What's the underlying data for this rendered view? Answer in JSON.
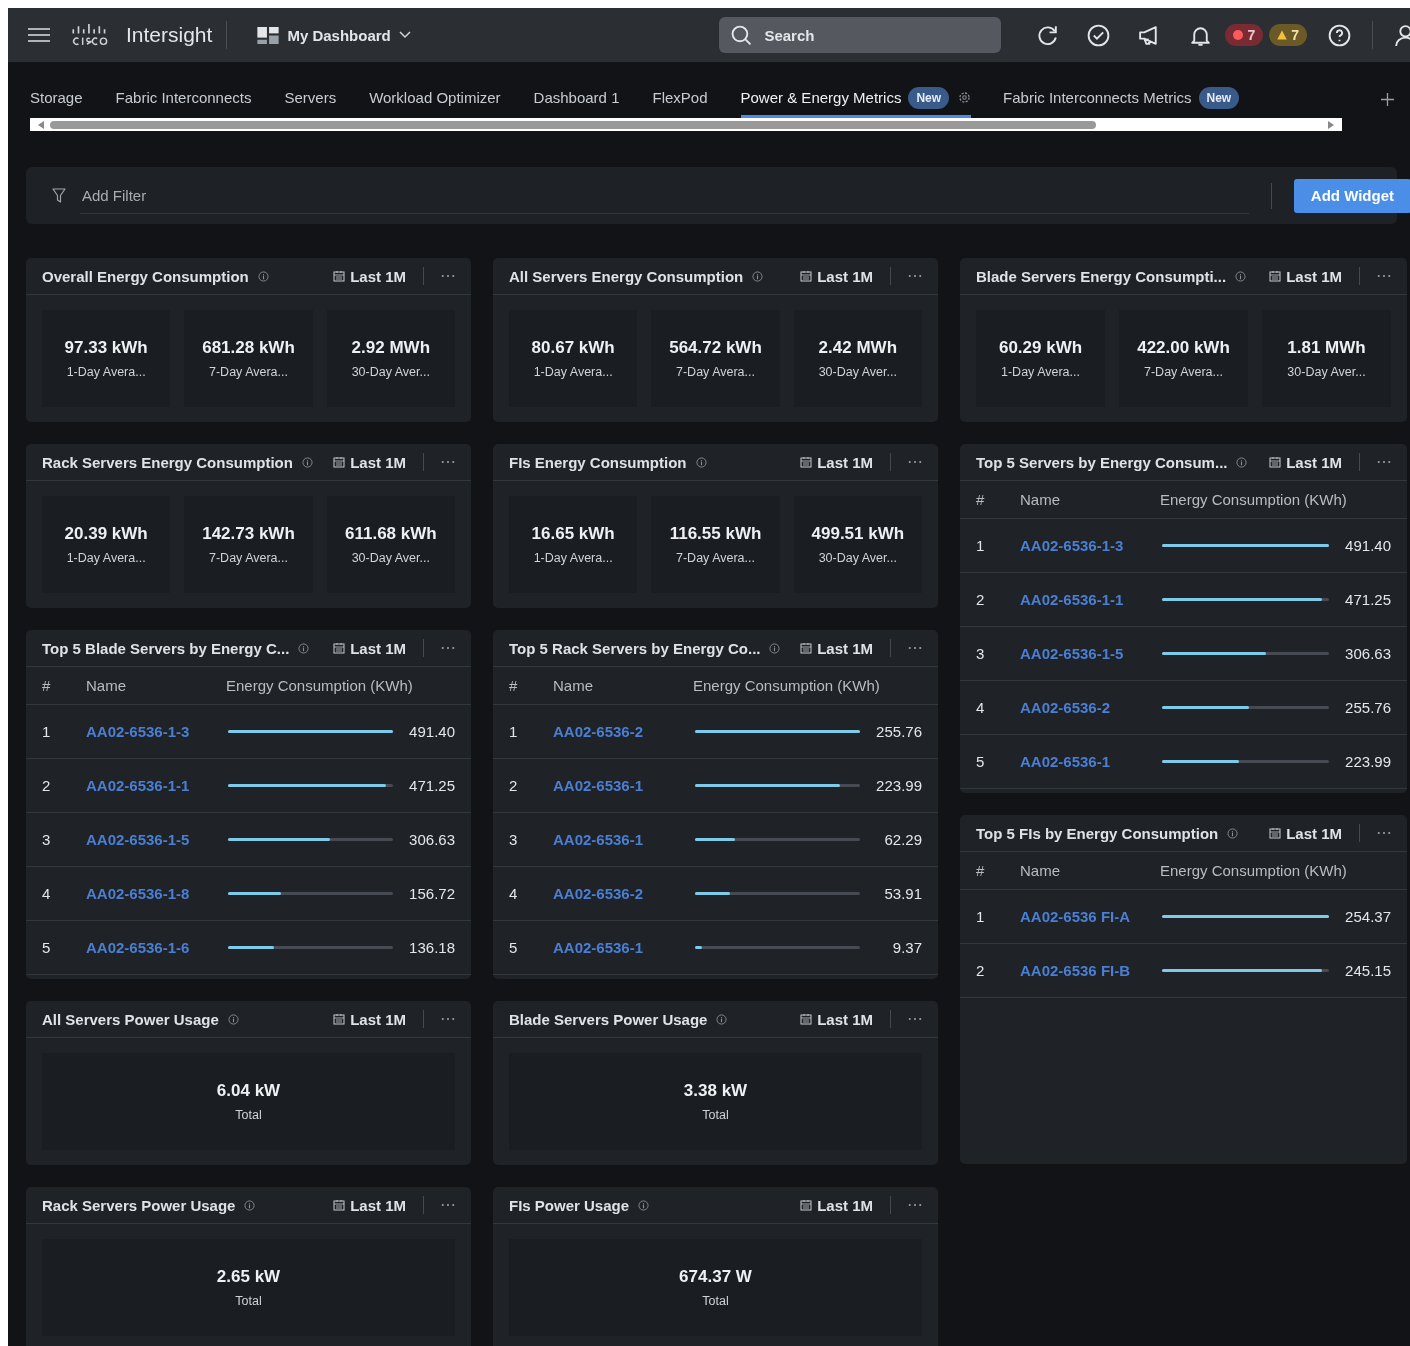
{
  "header": {
    "brand": "Intersight",
    "dashboard": "My Dashboard",
    "search": {
      "placeholder": "Search"
    },
    "alerts": [
      {
        "kind": "error",
        "count": "7"
      },
      {
        "kind": "warning",
        "count": "7"
      }
    ]
  },
  "tabs": [
    {
      "label": "Storage",
      "selected": false
    },
    {
      "label": "Fabric Interconnects",
      "selected": false
    },
    {
      "label": "Servers",
      "selected": false
    },
    {
      "label": "Workload Optimizer",
      "selected": false
    },
    {
      "label": "Dashboard 1",
      "selected": false
    },
    {
      "label": "FlexPod",
      "selected": false
    },
    {
      "label": "Power & Energy Metrics",
      "selected": true,
      "badge": "New",
      "settings": true
    },
    {
      "label": "Fabric Interconnects Metrics",
      "selected": false,
      "badge": "New",
      "settings": false
    }
  ],
  "filter": {
    "placeholder": "Add Filter"
  },
  "add_widget": "Add Widget",
  "columns": [
    [
      {
        "kind": "stats",
        "title": "Overall Energy Consumption",
        "range": "Last 1M",
        "stats": [
          {
            "value": "97.33 kWh",
            "label": "1-Day Avera..."
          },
          {
            "value": "681.28 kWh",
            "label": "7-Day Avera..."
          },
          {
            "value": "2.92 MWh",
            "label": "30-Day Aver..."
          }
        ]
      },
      {
        "kind": "stats",
        "title": "Rack Servers Energy Consumption",
        "range": "Last 1M",
        "stats": [
          {
            "value": "20.39 kWh",
            "label": "1-Day Avera..."
          },
          {
            "value": "142.73 kWh",
            "label": "7-Day Avera..."
          },
          {
            "value": "611.68 kWh",
            "label": "30-Day Aver..."
          }
        ]
      },
      {
        "kind": "table",
        "title": "Top 5 Blade Servers by Energy C...",
        "range": "Last 1M",
        "columns": [
          "#",
          "Name",
          "Energy Consumption (KWh)"
        ],
        "rows": [
          {
            "rank": "1",
            "name": "AA02-6536-1-3",
            "level": 1,
            "value": "491.40"
          },
          {
            "rank": "2",
            "name": "AA02-6536-1-1",
            "level": 0.96,
            "value": "471.25"
          },
          {
            "rank": "3",
            "name": "AA02-6536-1-5",
            "level": 0.62,
            "value": "306.63"
          },
          {
            "rank": "4",
            "name": "AA02-6536-1-8",
            "level": 0.32,
            "value": "156.72"
          },
          {
            "rank": "5",
            "name": "AA02-6536-1-6",
            "level": 0.28,
            "value": "136.18"
          }
        ]
      },
      {
        "kind": "total",
        "title": "All Servers Power Usage",
        "range": "Last 1M",
        "value": "6.04 kW",
        "label": "Total"
      },
      {
        "kind": "total",
        "title": "Rack Servers Power Usage",
        "range": "Last 1M",
        "value": "2.65 kW",
        "label": "Total"
      }
    ],
    [
      {
        "kind": "stats",
        "title": "All Servers Energy Consumption",
        "range": "Last 1M",
        "stats": [
          {
            "value": "80.67 kWh",
            "label": "1-Day Avera..."
          },
          {
            "value": "564.72 kWh",
            "label": "7-Day Avera..."
          },
          {
            "value": "2.42 MWh",
            "label": "30-Day Aver..."
          }
        ]
      },
      {
        "kind": "stats",
        "title": "FIs Energy Consumption",
        "range": "Last 1M",
        "stats": [
          {
            "value": "16.65 kWh",
            "label": "1-Day Avera..."
          },
          {
            "value": "116.55 kWh",
            "label": "7-Day Avera..."
          },
          {
            "value": "499.51 kWh",
            "label": "30-Day Aver..."
          }
        ]
      },
      {
        "kind": "table",
        "title": "Top 5 Rack Servers by Energy Co...",
        "range": "Last 1M",
        "columns": [
          "#",
          "Name",
          "Energy Consumption (KWh)"
        ],
        "rows": [
          {
            "rank": "1",
            "name": "AA02-6536-2",
            "level": 1,
            "value": "255.76"
          },
          {
            "rank": "2",
            "name": "AA02-6536-1",
            "level": 0.88,
            "value": "223.99"
          },
          {
            "rank": "3",
            "name": "AA02-6536-1",
            "level": 0.24,
            "value": "62.29"
          },
          {
            "rank": "4",
            "name": "AA02-6536-2",
            "level": 0.21,
            "value": "53.91"
          },
          {
            "rank": "5",
            "name": "AA02-6536-1",
            "level": 0.04,
            "value": "9.37"
          }
        ]
      },
      {
        "kind": "total",
        "title": "Blade Servers Power Usage",
        "range": "Last 1M",
        "value": "3.38 kW",
        "label": "Total"
      },
      {
        "kind": "total",
        "title": "FIs Power Usage",
        "range": "Last 1M",
        "value": "674.37 W",
        "label": "Total"
      }
    ],
    [
      {
        "kind": "stats",
        "title": "Blade Servers Energy Consumpti...",
        "range": "Last 1M",
        "stats": [
          {
            "value": "60.29 kWh",
            "label": "1-Day Avera..."
          },
          {
            "value": "422.00 kWh",
            "label": "7-Day Avera..."
          },
          {
            "value": "1.81 MWh",
            "label": "30-Day Aver..."
          }
        ]
      },
      {
        "kind": "table",
        "title": "Top 5 Servers by Energy Consum...",
        "range": "Last 1M",
        "columns": [
          "#",
          "Name",
          "Energy Consumption (KWh)"
        ],
        "rows": [
          {
            "rank": "1",
            "name": "AA02-6536-1-3",
            "level": 1,
            "value": "491.40"
          },
          {
            "rank": "2",
            "name": "AA02-6536-1-1",
            "level": 0.96,
            "value": "471.25"
          },
          {
            "rank": "3",
            "name": "AA02-6536-1-5",
            "level": 0.62,
            "value": "306.63"
          },
          {
            "rank": "4",
            "name": "AA02-6536-2",
            "level": 0.52,
            "value": "255.76"
          },
          {
            "rank": "5",
            "name": "AA02-6536-1",
            "level": 0.46,
            "value": "223.99"
          }
        ]
      },
      {
        "kind": "table",
        "title": "Top 5 FIs by Energy Consumption",
        "range": "Last 1M",
        "columns": [
          "#",
          "Name",
          "Energy Consumption (KWh)"
        ],
        "rows": [
          {
            "rank": "1",
            "name": "AA02-6536 FI-A",
            "level": 1,
            "value": "254.37"
          },
          {
            "rank": "2",
            "name": "AA02-6536 FI-B",
            "level": 0.96,
            "value": "245.15"
          }
        ]
      }
    ]
  ]
}
